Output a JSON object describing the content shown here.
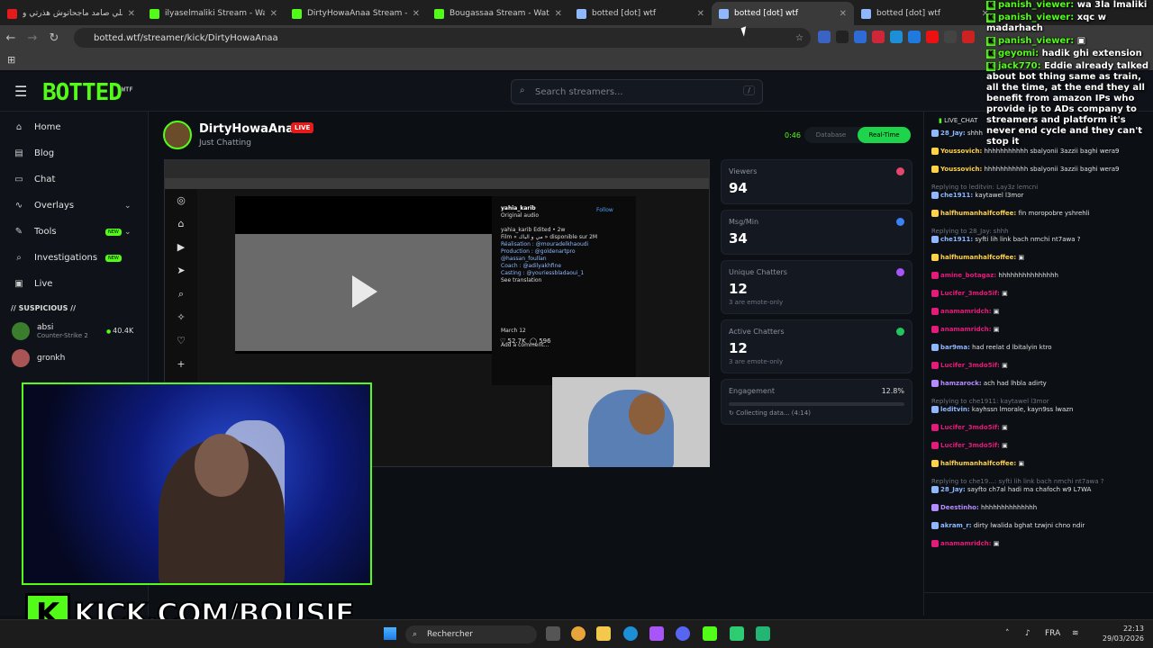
{
  "tabs": [
    {
      "title": "علي صامد ماجحاتوش هذرتي و",
      "color": "#e41b1b",
      "active": false
    },
    {
      "title": "ilyaselmaliki Stream - Watch",
      "color": "#53fc18",
      "active": false
    },
    {
      "title": "DirtyHowaAnaa Stream - W",
      "color": "#53fc18",
      "active": false
    },
    {
      "title": "Bougassaa Stream - Watch",
      "color": "#53fc18",
      "active": false
    },
    {
      "title": "botted [dot] wtf",
      "color": "#8fb8ff",
      "active": false
    },
    {
      "title": "botted [dot] wtf",
      "color": "#8fb8ff",
      "active": true
    },
    {
      "title": "botted [dot] wtf",
      "color": "#8fb8ff",
      "active": false
    }
  ],
  "browser": {
    "url": "botted.wtf/streamer/kick/DirtyHowaAnaa"
  },
  "site": {
    "logo": "BOTTED",
    "logo_sup": "WTF",
    "search_placeholder": "Search streamers...",
    "search_key": "/"
  },
  "nav": [
    {
      "label": "Home",
      "icon": "home-icon",
      "glyph": "⌂"
    },
    {
      "label": "Blog",
      "icon": "book-icon",
      "glyph": "▤"
    },
    {
      "label": "Chat",
      "icon": "chat-icon",
      "glyph": "▭"
    },
    {
      "label": "Overlays",
      "icon": "activity-icon",
      "glyph": "∿",
      "chevron": true
    },
    {
      "label": "Tools",
      "icon": "wrench-icon",
      "glyph": "✎",
      "badge": "NEW",
      "chevron": true
    },
    {
      "label": "Investigations",
      "icon": "search-icon",
      "glyph": "⌕",
      "badge": "NEW"
    },
    {
      "label": "Live",
      "icon": "tv-icon",
      "glyph": "▣"
    }
  ],
  "suspicious": {
    "title": "// SUSPICIOUS //",
    "items": [
      {
        "name": "absi",
        "game": "Counter-Strike 2",
        "count": "40.4K"
      },
      {
        "name": "gronkh",
        "game": "",
        "count": ""
      }
    ]
  },
  "channel": {
    "name": "DirtyHowaAnaa",
    "live": "LIVE",
    "category": "Just Chatting",
    "timer": "0:46",
    "mode_a": "Database",
    "mode_b": "Real-Time"
  },
  "video": {
    "poster": "yahia_karib",
    "poster_sub": "Original audio",
    "follow": "Follow",
    "caption_lines": [
      "yahia_karib Edited • 2w",
      "Film « مي و الباك » disponible sur 2M",
      "Réalisation : @mouradelkhaoudi",
      "Production : @goldenartpro",
      "@hassan_foullan",
      "Coach : @adilyakhfine",
      "Casting : @youriessbladaoui_1",
      "See translation"
    ],
    "likes": "52.7K",
    "comments": "596",
    "date": "March 12",
    "comment_placeholder": "Add a comment..."
  },
  "stats": {
    "viewers": {
      "label": "Viewers",
      "value": "94"
    },
    "msgmin": {
      "label": "Msg/Min",
      "value": "34"
    },
    "unique": {
      "label": "Unique Chatters",
      "value": "12",
      "sub": "3 are emote-only"
    },
    "active": {
      "label": "Active Chatters",
      "value": "12",
      "sub": "3 are emote-only"
    },
    "engagement": {
      "label": "Engagement",
      "pct": "12.8%",
      "status": "↻ Collecting data... (4:14)"
    }
  },
  "chat": {
    "title": "LIVE_CHAT",
    "messages": [
      {
        "u": "28_Jay:",
        "t": "shhh",
        "c": "#8fb8ff"
      },
      {
        "u": "Youssovich:",
        "t": "hhhhhhhhhhh sbalyonii 3azzii baghi wera9",
        "c": "#ffd24a"
      },
      {
        "u": "Youssovich:",
        "t": "hhhhhhhhhhh sbalyonii 3azzii baghi wera9",
        "c": "#ffd24a"
      },
      {
        "r": "Replying to leditvin: Lay3z lemcni",
        "u": "che1911:",
        "t": "kaytawel l3mor",
        "c": "#8fb8ff"
      },
      {
        "u": "halfhumanhalfcoffee:",
        "t": "fin moropobre yshrehli",
        "c": "#ffd24a"
      },
      {
        "r": "Replying to 28_Jay: shhh",
        "u": "che1911:",
        "t": "syfti lih link bach nmchi nt7awa ?",
        "c": "#8fb8ff"
      },
      {
        "u": "halfhumanhalfcoffee:",
        "t": "▣",
        "c": "#ffd24a"
      },
      {
        "u": "amine_botagaz:",
        "t": "hhhhhhhhhhhhhhh",
        "c": "#e41b7a"
      },
      {
        "u": "Lucifer_3mdo5if:",
        "t": "▣",
        "c": "#e41b7a"
      },
      {
        "u": "anamamridch:",
        "t": "▣",
        "c": "#e41b7a"
      },
      {
        "u": "anamamridch:",
        "t": "▣",
        "c": "#e41b7a"
      },
      {
        "u": "bar9ma:",
        "t": "had reelat d lbitalyin ktro",
        "c": "#8fb8ff"
      },
      {
        "u": "Lucifer_3mdo5if:",
        "t": "▣",
        "c": "#e41b7a"
      },
      {
        "u": "hamzarock:",
        "t": "ach had lhbla adirty",
        "c": "#b48cff"
      },
      {
        "r": "Replying to che1911: kaytawel l3mor",
        "u": "leditvin:",
        "t": "kayhssn lmorale, kayn9ss lwazn",
        "c": "#8fb8ff"
      },
      {
        "u": "Lucifer_3mdo5if:",
        "t": "▣",
        "c": "#e41b7a"
      },
      {
        "u": "Lucifer_3mdo5if:",
        "t": "▣",
        "c": "#e41b7a"
      },
      {
        "u": "halfhumanhalfcoffee:",
        "t": "▣",
        "c": "#ffd24a"
      },
      {
        "r": "Replying to che19...: syfti lih link bach nmchi nt7awa ?",
        "u": "28_Jay:",
        "t": "sayfto ch7al hadi ma chafoch w9 L7WA",
        "c": "#8fb8ff"
      },
      {
        "u": "Deestinho:",
        "t": "hhhhhhhhhhhhhh",
        "c": "#b48cff"
      },
      {
        "u": "akram_r:",
        "t": "dirty lwalida bghat tzwjni chno ndir",
        "c": "#8fb8ff"
      },
      {
        "u": "anamamridch:",
        "t": "▣",
        "c": "#e41b7a"
      }
    ]
  },
  "overlay_chat": [
    {
      "u": "panish_viewer:",
      "t": "wa 3la lmaliki"
    },
    {
      "u": "panish_viewer:",
      "t": "xqc w madarhach"
    },
    {
      "u": "panish_viewer:",
      "t": "▣"
    },
    {
      "u": "geyomi:",
      "t": "hadik ghi extension"
    },
    {
      "u": "jack770:",
      "t": "Eddie already talked about bot thing same as train, all the time, at the end they all benefit from amazon IPs who provide ip to ADs company to streamers and platform it's never end cycle and they can't stop it"
    }
  ],
  "overlay": {
    "kick_text": "KICK.COM/BOUSIF",
    "k": "K"
  },
  "taskbar": {
    "search": "Rechercher",
    "lang": "FRA",
    "time": "22:13",
    "date": "29/03/2026"
  }
}
